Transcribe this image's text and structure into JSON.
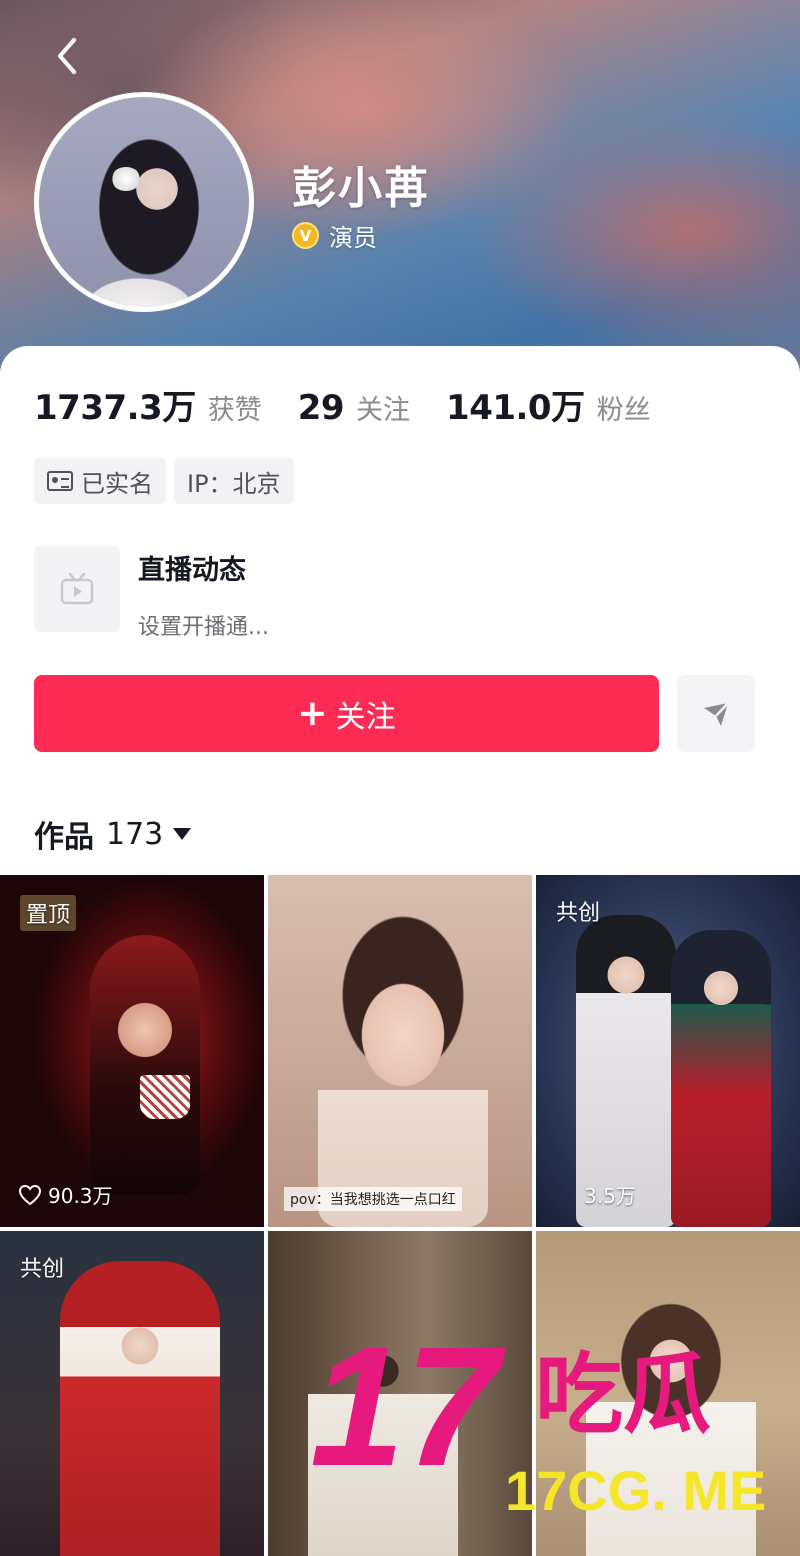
{
  "header": {
    "back_icon": "chevron-left-icon",
    "name": "彭小苒",
    "verified_label": "演员",
    "verified_icon_letter": "V",
    "verified_color": "#f2b81f"
  },
  "stats": {
    "likes_value": "1737.3万",
    "likes_label": "获赞",
    "following_value": "29",
    "following_label": "关注",
    "followers_value": "141.0万",
    "followers_label": "粉丝"
  },
  "tags": {
    "realname": "已实名",
    "ip": "IP：北京"
  },
  "live": {
    "title": "直播动态",
    "subtitle": "设置开播通..."
  },
  "actions": {
    "follow_plus": "+",
    "follow_label": "关注",
    "follow_color": "#fe2c55",
    "share_icon": "share-arrow-icon"
  },
  "works": {
    "label": "作品",
    "count": "173"
  },
  "grid": [
    {
      "badge": "置顶",
      "likes": "90.3万"
    },
    {
      "badge": "",
      "likes": "",
      "caption": "pov：当我想挑选一点口红"
    },
    {
      "badge": "共创",
      "likes": "3.5万"
    },
    {
      "badge": "共创",
      "likes": ""
    },
    {
      "badge": "",
      "likes": ""
    },
    {
      "badge": "",
      "likes": ""
    }
  ],
  "watermark": {
    "big": "17",
    "chinese": "吃瓜",
    "site": "17CG. ME"
  }
}
